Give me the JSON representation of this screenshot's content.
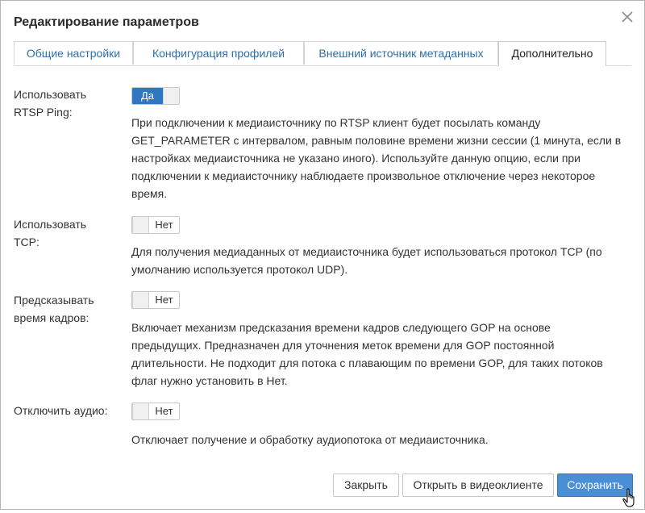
{
  "dialog": {
    "title": "Редактирование параметров",
    "close_icon": "close-icon"
  },
  "tabs": [
    {
      "label": "Общие настройки"
    },
    {
      "label": "Конфигурация профилей"
    },
    {
      "label": "Внешний источник метаданных"
    },
    {
      "label": "Дополнительно",
      "active": true
    }
  ],
  "settings": [
    {
      "label": "Использовать RTSP Ping:",
      "toggle_value": "Да",
      "description": "При подключении к медиаисточнику по RTSP клиент будет посылать команду GET_PARAMETER с интервалом, равным половине времени жизни сессии (1 минута, если в настройках медиаисточника не указано иного). Используйте данную опцию, если при подключении к медиаисточнику наблюдаете произвольное отключение через некоторое время."
    },
    {
      "label": "Использовать TCP:",
      "toggle_value": "Нет",
      "description": "Для получения медиаданных от медиаисточника будет использоваться протокол TCP (по умолчанию используется протокол UDP)."
    },
    {
      "label": "Предсказывать время кадров:",
      "toggle_value": "Нет",
      "description": "Включает механизм предсказания времени кадров следующего GOP на основе предыдущих. Предназначен для уточнения меток времени для GOP постоянной длительности. Не подходит для потока с плавающим по времени GOP, для таких потоков флаг нужно установить в Нет."
    },
    {
      "label": "Отключить аудио:",
      "toggle_value": "Нет",
      "description": "Отключает получение и обработку аудиопотока от медиаисточника."
    }
  ],
  "buttons": {
    "close": "Закрыть",
    "open_in_client": "Открыть в видеоклиенте",
    "save": "Сохранить"
  },
  "colors": {
    "accent": "#2f77c1",
    "tab_link": "#2f6fa8"
  }
}
